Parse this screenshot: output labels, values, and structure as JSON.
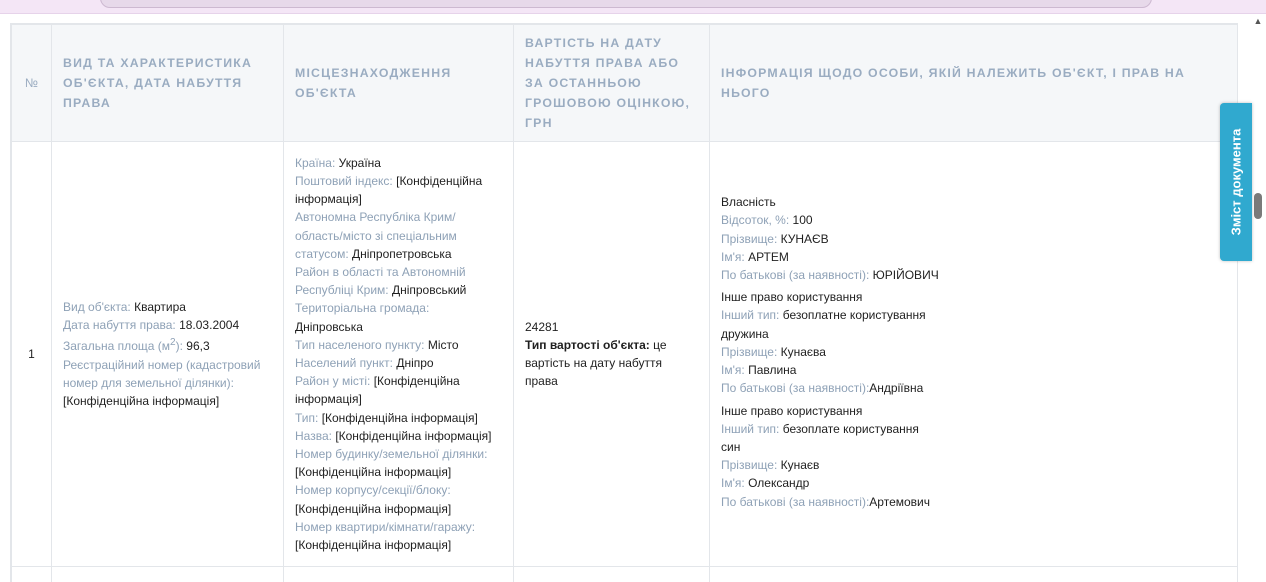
{
  "side_tab": {
    "label": "Зміст документа"
  },
  "table": {
    "headers": [
      "№",
      "ВИД ТА ХАРАКТЕРИСТИКА ОБ'ЄКТА, ДАТА НАБУТТЯ ПРАВА",
      "МІСЦЕЗНАХОДЖЕННЯ ОБ'ЄКТА",
      "ВАРТІСТЬ НА ДАТУ НАБУТТЯ ПРАВА АБО ЗА ОСТАННЬОЮ ГРОШОВОЮ ОЦІНКОЮ, ГРН",
      "ІНФОРМАЦІЯ ЩОДО ОСОБИ, ЯКІЙ НАЛЕЖИТЬ ОБ'ЄКТ, І ПРАВ НА НЬОГО"
    ],
    "row": {
      "num": "1",
      "object": {
        "type_label": "Вид об'єкта:",
        "type_value": "Квартира",
        "date_label": "Дата набуття права:",
        "date_value": "18.03.2004",
        "area_label": "Загальна площа (м",
        "area_sup": "2",
        "area_label_end": "):",
        "area_value": "96,3",
        "reg_label": "Реєстраційний номер (кадастровий номер для земельної ділянки):",
        "reg_value": "[Конфіденційна інформація]"
      },
      "location": [
        {
          "label": "Країна:",
          "value": "Україна"
        },
        {
          "label": "Поштовий індекс:",
          "value": "[Конфіденційна інформація]"
        },
        {
          "label": "Автономна Республіка Крим/ область/місто зі спеціальним статусом:",
          "value": "Дніпропетровська"
        },
        {
          "label": "Район в області та Автономній Республіці Крим:",
          "value": "Дніпровський"
        },
        {
          "label": "Територіальна громада:",
          "value": "Дніпровська"
        },
        {
          "label": "Тип населеного пункту:",
          "value": "Місто"
        },
        {
          "label": "Населений пункт:",
          "value": "Дніпро"
        },
        {
          "label": "Район у місті:",
          "value": "[Конфіденційна інформація]"
        },
        {
          "label": "Тип:",
          "value": "[Конфіденційна інформація]"
        },
        {
          "label": "Назва:",
          "value": "[Конфіденційна інформація]"
        },
        {
          "label": "Номер будинку/земельної ділянки:",
          "value": "[Конфіденційна інформація]"
        },
        {
          "label": "Номер корпусу/секції/блоку:",
          "value": "[Конфіденційна інформація]"
        },
        {
          "label": "Номер квартири/кімнати/гаражу:",
          "value": "[Конфіденційна інформація]"
        }
      ],
      "value": {
        "amount": "24281",
        "type_label": "Тип вартості об'єкта:",
        "type_value": "це вартість на дату набуття права"
      },
      "persons": {
        "owner": {
          "title": "Власність",
          "percent_label": "Відсоток, %:",
          "percent_value": "100",
          "surname_label": "Прізвище:",
          "surname_value": "КУНАЄВ",
          "name_label": "Ім'я:",
          "name_value": "АРТЕМ",
          "patronymic_label": "По батькові (за наявності):",
          "patronymic_value": "ЮРІЙОВИЧ"
        },
        "other1": {
          "title": "Інше право користування",
          "type_label": "Інший тип:",
          "type_value": "безоплатне користування дружина",
          "surname_label": "Прізвище:",
          "surname_value": "Кунаєва",
          "name_label": "Ім'я:",
          "name_value": "Павлина",
          "patronymic_label": "По батькові (за наявності):",
          "patronymic_value": "Андріївна"
        },
        "other2": {
          "title": "Інше право користування",
          "type_label": "Інший тип:",
          "type_value": "безоплате користування син",
          "surname_label": "Прізвище:",
          "surname_value": "Кунаєв",
          "name_label": "Ім'я:",
          "name_value": "Олександр",
          "patronymic_label": "По батькові (за наявності):",
          "patronymic_value": "Артемович"
        }
      }
    }
  }
}
